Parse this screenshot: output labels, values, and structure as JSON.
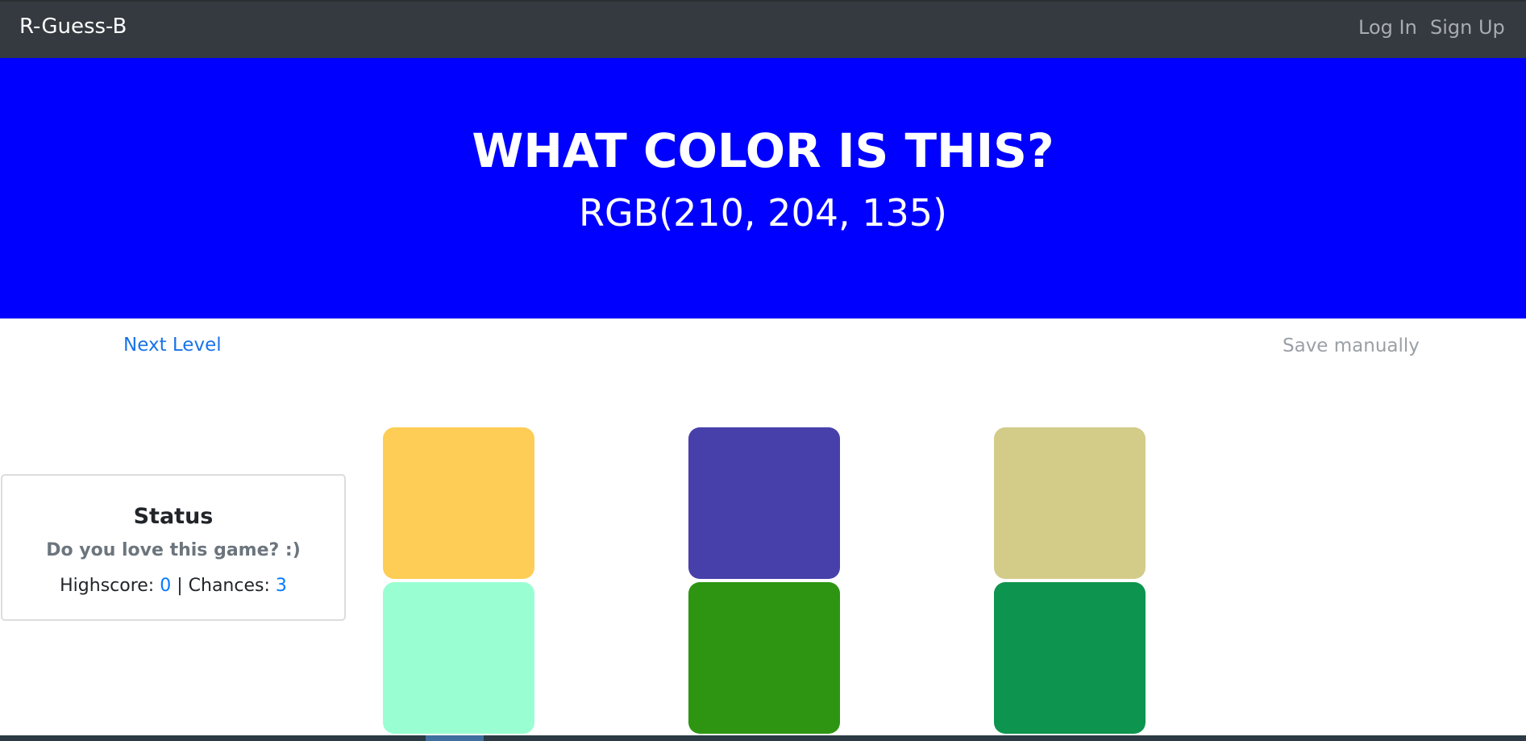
{
  "navbar": {
    "brand": "R-Guess-B",
    "login": "Log In",
    "signup": "Sign Up"
  },
  "hero": {
    "title": "WHAT COLOR IS THIS?",
    "rgb": "RGB(210, 204, 135)",
    "background_color": "#0000ff"
  },
  "actions": {
    "next_level": "Next Level",
    "save_manually": "Save manually",
    "link_color": "#1a73e8"
  },
  "status": {
    "title": "Status",
    "subtitle": "Do you love this game? :)",
    "highscore_label": "Highscore:",
    "highscore": "0",
    "separator": "|",
    "chances_label": "Chances:",
    "chances": "3"
  },
  "swatches": [
    {
      "color": "#fecd55"
    },
    {
      "color": "#4840aa"
    },
    {
      "color": "#d3cc89"
    },
    {
      "color": "#99ffd3"
    },
    {
      "color": "#2e9512"
    },
    {
      "color": "#0d944f"
    }
  ]
}
